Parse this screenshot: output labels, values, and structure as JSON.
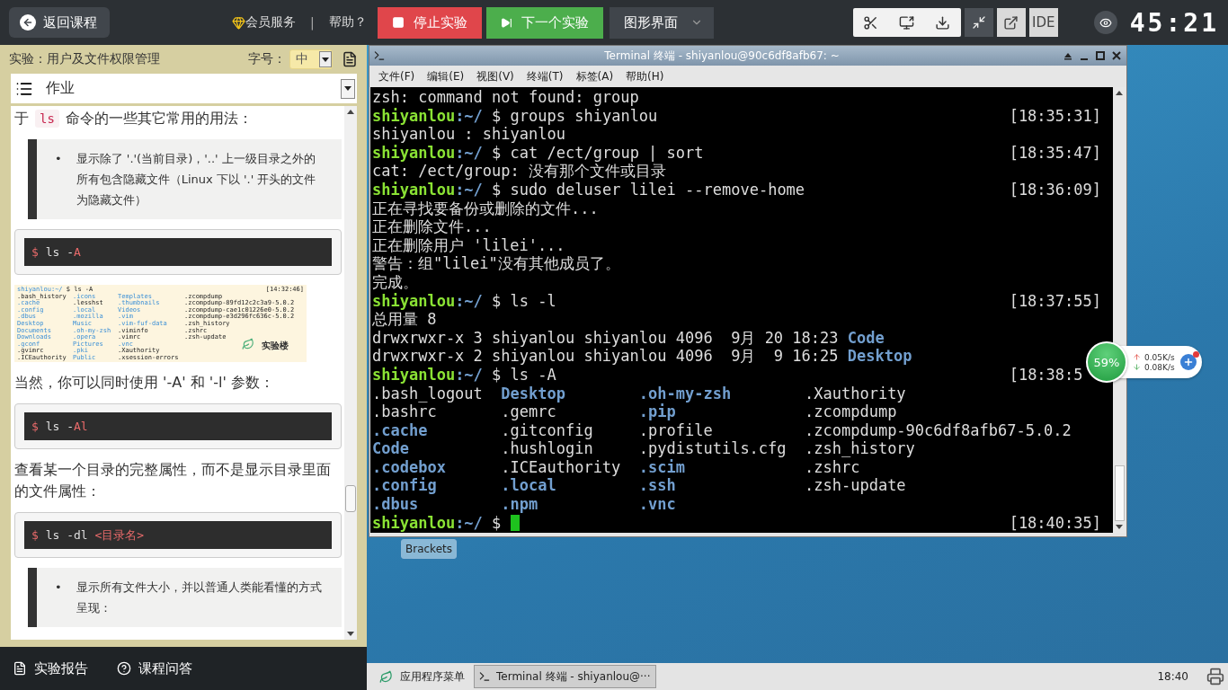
{
  "top_bar": {
    "back_button": "返回课程",
    "vip_link": "会员服务",
    "separator": "|",
    "help_link": "帮助？",
    "stop_button": "停止实验",
    "next_button": "下一个实验",
    "mode_select": "图形界面",
    "ide_button": "IDE",
    "timer": "45:21"
  },
  "lesson_panel": {
    "title": "实验：用户及文件权限管理",
    "font_size_label": "字号：",
    "font_size_value": "中",
    "section_select": "作业",
    "content": [
      {
        "kind": "paragraph",
        "parts": [
          {
            "text": "于 ",
            "code": false
          },
          {
            "text": "ls",
            "code": true
          },
          {
            "text": " 命令的一些其它常用的用法：",
            "code": false
          }
        ]
      },
      {
        "kind": "note",
        "bullet": "•",
        "text": "显示除了 '.'(当前目录)，'..' 上一级目录之外的所有包含隐藏文件（Linux 下以 '.' 开头的文件为隐藏文件）"
      },
      {
        "kind": "code",
        "parts": [
          {
            "text": "$",
            "hl": true
          },
          {
            "text": " ls -",
            "hl": false
          },
          {
            "text": "A",
            "hl": true
          }
        ]
      },
      {
        "kind": "screenshot",
        "prompt": "shiyanlou:~/",
        "command": "$ ls -A",
        "time": "[14:32:46]",
        "logo": "实验楼",
        "rows": [
          [
            {
              "text": ".bash_history",
              "dir": false
            },
            {
              "text": ".icons",
              "dir": true
            },
            {
              "text": "Templates",
              "dir": true
            },
            {
              "text": ".zcompdump",
              "dir": false
            }
          ],
          [
            {
              "text": ".cache",
              "dir": true
            },
            {
              "text": ".lesshst",
              "dir": false
            },
            {
              "text": ".thumbnails",
              "dir": true
            },
            {
              "text": ".zcompdump-89fd12c2c3a9-5.0.2",
              "dir": false
            }
          ],
          [
            {
              "text": ".config",
              "dir": true
            },
            {
              "text": ".local",
              "dir": true
            },
            {
              "text": "Videos",
              "dir": true
            },
            {
              "text": ".zcompdump-cae1c01226e0-5.0.2",
              "dir": false
            }
          ],
          [
            {
              "text": ".dbus",
              "dir": true
            },
            {
              "text": ".mozilla",
              "dir": true
            },
            {
              "text": ".vim",
              "dir": true
            },
            {
              "text": ".zcompdump-e3d296fc636c-5.0.2",
              "dir": false
            }
          ],
          [
            {
              "text": "Desktop",
              "dir": true
            },
            {
              "text": "Music",
              "dir": true
            },
            {
              "text": ".vim-fuf-data",
              "dir": true
            },
            {
              "text": ".zsh_history",
              "dir": false
            }
          ],
          [
            {
              "text": "Documents",
              "dir": true
            },
            {
              "text": ".oh-my-zsh",
              "dir": true
            },
            {
              "text": ".viminfo",
              "dir": false
            },
            {
              "text": ".zshrc",
              "dir": false
            }
          ],
          [
            {
              "text": "Downloads",
              "dir": true
            },
            {
              "text": ".opera",
              "dir": true
            },
            {
              "text": ".vimrc",
              "dir": false
            },
            {
              "text": ".zsh-update",
              "dir": false
            }
          ],
          [
            {
              "text": ".gconf",
              "dir": true
            },
            {
              "text": "Pictures",
              "dir": true
            },
            {
              "text": ".vnc",
              "dir": true
            }
          ],
          [
            {
              "text": ".gvimrc",
              "dir": false
            },
            {
              "text": ".pki",
              "dir": true
            },
            {
              "text": ".Xauthority",
              "dir": false
            }
          ],
          [
            {
              "text": ".ICEauthority",
              "dir": false
            },
            {
              "text": "Public",
              "dir": true
            },
            {
              "text": ".xsession-errors",
              "dir": false
            }
          ]
        ]
      },
      {
        "kind": "paragraph",
        "parts": [
          {
            "text": "当然，你可以同时使用 '-A' 和 '-l' 参数：",
            "code": false
          }
        ]
      },
      {
        "kind": "code",
        "parts": [
          {
            "text": "$",
            "hl": true
          },
          {
            "text": " ls -",
            "hl": false
          },
          {
            "text": "Al",
            "hl": true
          }
        ]
      },
      {
        "kind": "paragraph",
        "parts": [
          {
            "text": "查看某一个目录的完整属性，而不是显示目录里面的文件属性：",
            "code": false
          }
        ]
      },
      {
        "kind": "code",
        "parts": [
          {
            "text": "$",
            "hl": true
          },
          {
            "text": " ls -dl ",
            "hl": false
          },
          {
            "text": "<目录名>",
            "hl": true
          }
        ]
      },
      {
        "kind": "note",
        "bullet": "•",
        "text": "显示所有文件大小，并以普通人类能看懂的方式呈现："
      }
    ]
  },
  "bottom_links": [
    {
      "kind": "report",
      "label": "实验报告"
    },
    {
      "kind": "qa",
      "label": "课程问答"
    }
  ],
  "terminal": {
    "title": "Terminal 终端 - shiyanlou@90c6df8afb67: ~",
    "menu": [
      "文件(F)",
      "编辑(E)",
      "视图(V)",
      "终端(T)",
      "标签(A)",
      "帮助(H)"
    ],
    "lines": [
      {
        "kind": "output",
        "text": "zsh: command not found: group"
      },
      {
        "kind": "prompt",
        "user": "shiyanlou",
        "path": ":~/",
        "symbol": "$",
        "command": "groups shiyanlou",
        "time": "[18:35:31]",
        "cursor": false
      },
      {
        "kind": "output",
        "text": "shiyanlou : shiyanlou"
      },
      {
        "kind": "prompt",
        "user": "shiyanlou",
        "path": ":~/",
        "symbol": "$",
        "command": "cat /ect/group | sort",
        "time": "[18:35:47]",
        "cursor": false
      },
      {
        "kind": "output",
        "text": "cat: /ect/group: 没有那个文件或目录"
      },
      {
        "kind": "prompt",
        "user": "shiyanlou",
        "path": ":~/",
        "symbol": "$",
        "command": "sudo deluser lilei --remove-home",
        "time": "[18:36:09]",
        "cursor": false
      },
      {
        "kind": "output",
        "text": "正在寻找要备份或删除的文件..."
      },
      {
        "kind": "output",
        "text": "正在删除文件..."
      },
      {
        "kind": "output",
        "text": "正在删除用户 'lilei'..."
      },
      {
        "kind": "output",
        "text": "警告：组\"lilei\"没有其他成员了。"
      },
      {
        "kind": "output",
        "text": "完成。"
      },
      {
        "kind": "prompt",
        "user": "shiyanlou",
        "path": ":~/",
        "symbol": "$",
        "command": "ls -l",
        "time": "[18:37:55]",
        "cursor": false
      },
      {
        "kind": "output",
        "text": "总用量 8"
      },
      {
        "kind": "entry",
        "text": "drwxrwxr-x 3 shiyanlou shiyanlou 4096  9月 20 18:23",
        "name": "Code"
      },
      {
        "kind": "entry",
        "text": "drwxrwxr-x 2 shiyanlou shiyanlou 4096  9月  9 16:25",
        "name": "Desktop"
      },
      {
        "kind": "prompt",
        "user": "shiyanlou",
        "path": ":~/",
        "symbol": "$",
        "command": "ls -A",
        "time": "[18:38:5",
        "cursor": false
      },
      {
        "kind": "columns",
        "cells": [
          {
            "text": ".bash_logout",
            "dir": false
          },
          {
            "text": "Desktop",
            "dir": true
          },
          {
            "text": ".oh-my-zsh",
            "dir": true
          },
          {
            "text": ".Xauthority",
            "dir": false
          }
        ]
      },
      {
        "kind": "columns",
        "cells": [
          {
            "text": ".bashrc",
            "dir": false
          },
          {
            "text": ".gemrc",
            "dir": false
          },
          {
            "text": ".pip",
            "dir": true
          },
          {
            "text": ".zcompdump",
            "dir": false
          }
        ]
      },
      {
        "kind": "columns",
        "cells": [
          {
            "text": ".cache",
            "dir": true
          },
          {
            "text": ".gitconfig",
            "dir": false
          },
          {
            "text": ".profile",
            "dir": false
          },
          {
            "text": ".zcompdump-90c6df8afb67-5.0.2",
            "dir": false
          }
        ]
      },
      {
        "kind": "columns",
        "cells": [
          {
            "text": "Code",
            "dir": true
          },
          {
            "text": ".hushlogin",
            "dir": false
          },
          {
            "text": ".pydistutils.cfg",
            "dir": false
          },
          {
            "text": ".zsh_history",
            "dir": false
          }
        ]
      },
      {
        "kind": "columns",
        "cells": [
          {
            "text": ".codebox",
            "dir": true
          },
          {
            "text": ".ICEauthority",
            "dir": false
          },
          {
            "text": ".scim",
            "dir": true
          },
          {
            "text": ".zshrc",
            "dir": false
          }
        ]
      },
      {
        "kind": "columns",
        "cells": [
          {
            "text": ".config",
            "dir": true
          },
          {
            "text": ".local",
            "dir": true
          },
          {
            "text": ".ssh",
            "dir": true
          },
          {
            "text": ".zsh-update",
            "dir": false
          }
        ]
      },
      {
        "kind": "columns",
        "cells": [
          {
            "text": ".dbus",
            "dir": true
          },
          {
            "text": ".npm",
            "dir": true
          },
          {
            "text": ".vnc",
            "dir": true
          }
        ]
      },
      {
        "kind": "prompt",
        "user": "shiyanlou",
        "path": ":~/",
        "symbol": "$",
        "time": "[18:40:35]",
        "cursor": true
      }
    ]
  },
  "network_widget": {
    "percent": "59%",
    "upload": "0.05K/s",
    "download": "0.08K/s"
  },
  "desktop_icons": [
    {
      "label": "Brackets"
    }
  ],
  "taskbar": {
    "app_menu": "应用程序菜单",
    "tasks": [
      {
        "label": "Terminal 终端 - shiyanlou@···",
        "selected": true
      }
    ],
    "clock": "18:40"
  }
}
